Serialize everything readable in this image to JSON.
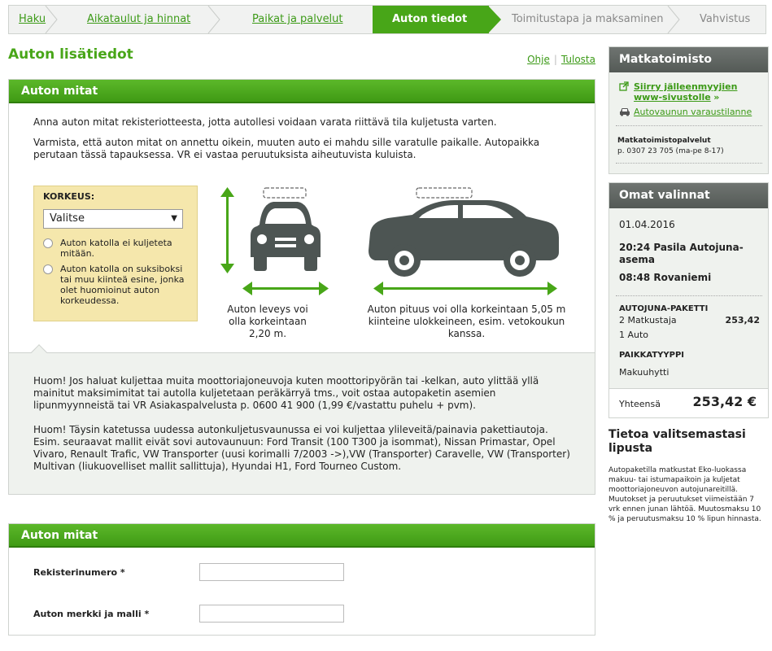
{
  "steps": [
    {
      "label": "Haku"
    },
    {
      "label": "Aikataulut ja hinnat"
    },
    {
      "label": "Paikat ja palvelut"
    },
    {
      "label": "Auton tiedot"
    },
    {
      "label": "Toimitustapa ja maksaminen"
    },
    {
      "label": "Vahvistus"
    }
  ],
  "page": {
    "title": "Auton lisätiedot",
    "help_link": "Ohje",
    "print_link": "Tulosta"
  },
  "dimensions": {
    "heading": "Auton mitat",
    "intro1": "Anna auton mitat rekisteriotteesta, jotta autollesi voidaan varata riittävä tila kuljetusta varten.",
    "intro2": "Varmista, että auton mitat on annettu oikein, muuten auto ei mahdu sille varatulle paikalle. Autopaikka perutaan tässä tapauksessa. VR ei vastaa peruutuksista aiheutuvista kuluista.",
    "height_label": "KORKEUS:",
    "height_select": "Valitse",
    "radio1": "Auton katolla ei kuljeteta mitään.",
    "radio2": "Auton katolla on suksiboksi tai muu kiinteä esine, jonka olet huomioinut auton korkeudessa.",
    "width_caption": "Auton leveys voi olla korkeintaan 2,20 m.",
    "length_caption": "Auton pituus voi olla korkeintaan 5,05 m kiinteine ulokkeineen, esim. vetokoukun kanssa.",
    "note1": "Huom! Jos haluat kuljettaa muita moottoriajoneuvoja kuten moottoripyörän tai -kelkan, auto ylittää yllä mainitut maksimimitat tai autolla kuljetetaan peräkärryä tms., voit ostaa autopaketin asemien lipunmyynneistä tai VR Asiakaspalvelusta p. 0600 41 900 (1,99 €/vastattu puhelu + pvm).",
    "note2": "Huom! Täysin katetussa uudessa autonkuljetusvaunussa ei voi kuljettaa ylileveitä/painavia pakettiautoja. Esim. seuraavat mallit eivät sovi autovaunuun: Ford Transit (100 T300 ja isommat), Nissan Primastar, Opel Vivaro, Renault Trafic, VW Transporter (uusi korimalli 7/2003 ->),VW (Transporter) Caravelle, VW (Transporter) Multivan (liukuovelliset mallit sallittuja), Hyundai H1, Ford Tourneo Custom."
  },
  "form": {
    "heading": "Auton mitat",
    "reg_label": "Rekisterinumero *",
    "reg_value": "",
    "model_label": "Auton merkki ja malli *",
    "model_value": ""
  },
  "agency": {
    "heading": "Matkatoimisto",
    "link1": "Siirry jälleenmyyjien www-sivustolle",
    "link1_suffix": "»",
    "link2": "Autovaunun varaustilanne",
    "services_title": "Matkatoimistopalvelut",
    "services_phone": "p. 0307 23 705 (ma-pe 8-17)"
  },
  "selection": {
    "heading": "Omat valinnat",
    "date": "01.04.2016",
    "departure": "20:24 Pasila Autojuna-asema",
    "arrival": "08:48 Rovaniemi",
    "package_title": "AUTOJUNA-PAKETTI",
    "package_line1": "2 Matkustaja",
    "package_price": "253,42",
    "package_line2": "1 Auto",
    "seat_title": "PAIKKATYYPPI",
    "seat_value": "Makuuhytti",
    "total_label": "Yhteensä",
    "total_value": "253,42 €"
  },
  "info": {
    "title": "Tietoa valitsemastasi lipusta",
    "text": "Autopaketilla matkustat Eko-luokassa makuu- tai istumapaikoin ja kuljetat moottoriajoneuvon autojunareitillä. Muutokset ja peruutukset viimeistään 7 vrk ennen junan lähtöä. Muutosmaksu 10 % ja peruutusmaksu 10 % lipun hinnasta."
  },
  "colors": {
    "accent": "#48a618",
    "sidebar_head": "#5e6460",
    "car": "#4d5553"
  }
}
